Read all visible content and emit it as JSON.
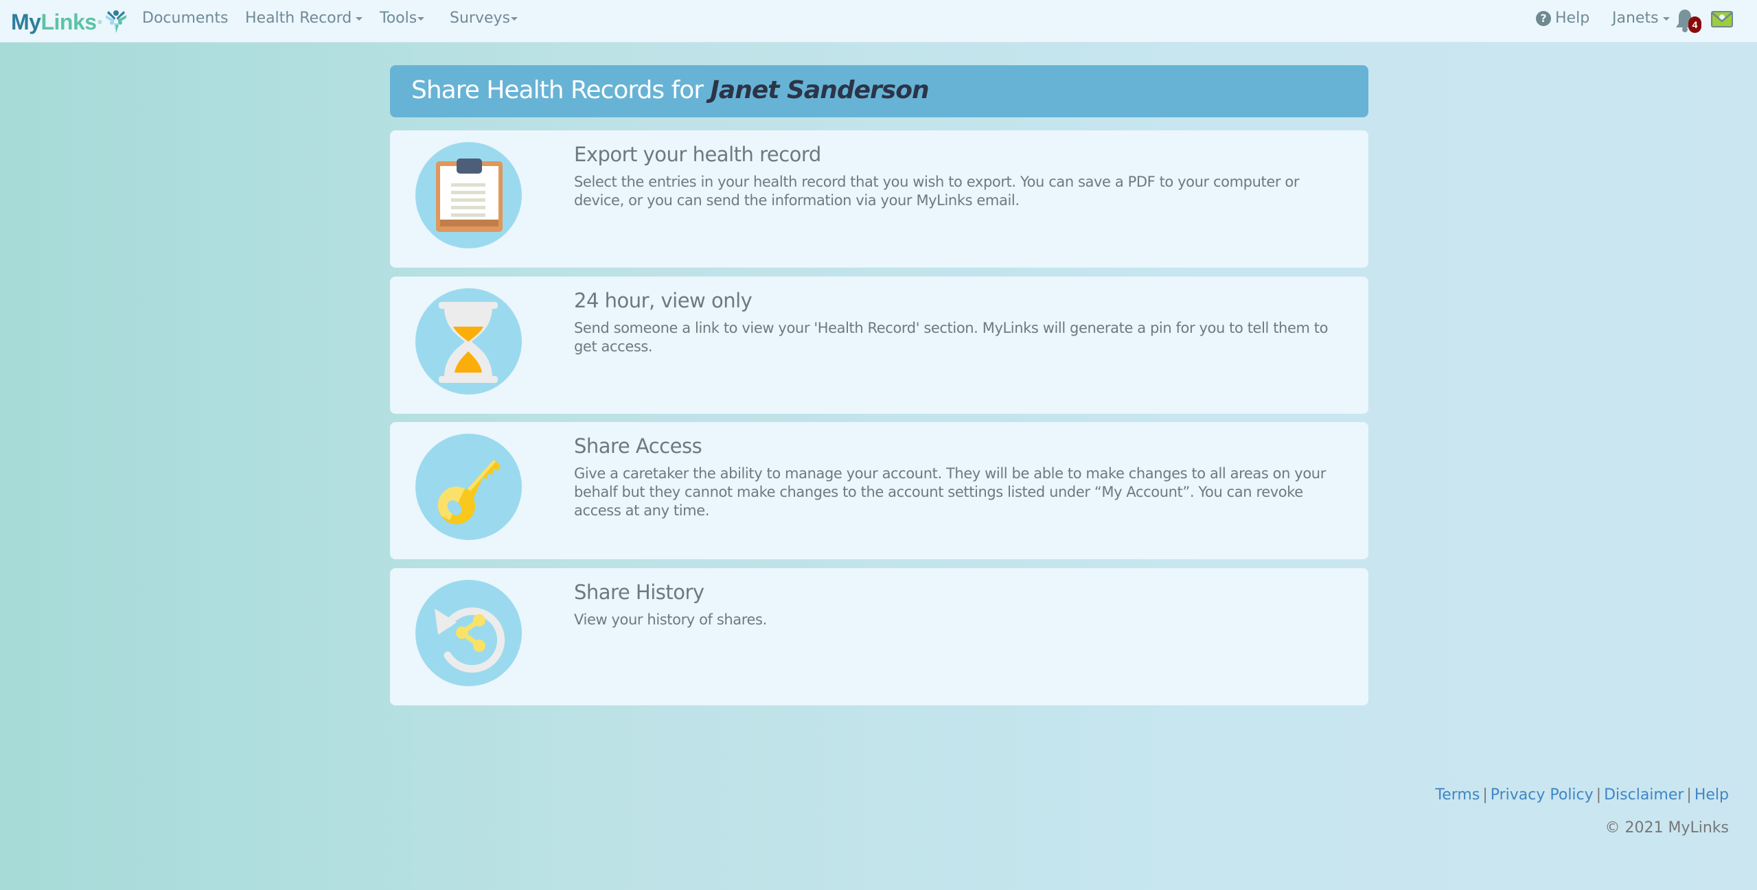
{
  "navbar": {
    "logo": {
      "my": "My",
      "links": "Links",
      "reg": "®"
    },
    "items": [
      {
        "label": "Documents",
        "has_dropdown": false
      },
      {
        "label": "Health Record",
        "has_dropdown": true
      },
      {
        "label": "Tools",
        "has_dropdown": true
      },
      {
        "label": "Surveys",
        "has_dropdown": true
      }
    ],
    "help_label": "Help",
    "help_icon": "question-circle-icon",
    "user_label": "Janets",
    "notification_icon": "bell-icon",
    "notification_count": "4",
    "mail_icon": "envelope-icon"
  },
  "banner": {
    "title_prefix": "Share Health Records for ",
    "patient_name": "Janet Sanderson"
  },
  "cards": [
    {
      "icon": "clipboard-icon",
      "title": "Export your health record",
      "description": "Select the entries in your health record that you wish to export. You can save a PDF to your computer or device, or you can send the information via your MyLinks email."
    },
    {
      "icon": "hourglass-icon",
      "title": "24 hour, view only",
      "description": "Send someone a link to view your 'Health Record' section. MyLinks will generate a pin for you to tell them to get access."
    },
    {
      "icon": "key-icon",
      "title": "Share Access",
      "description": "Give a caretaker the ability to manage your account. They will be able to make changes to all areas on your behalf but they cannot make changes to the account settings listed under “My Account”. You can revoke access at any time."
    },
    {
      "icon": "share-history-icon",
      "title": "Share History",
      "description": "View your history of shares."
    }
  ],
  "footer": {
    "links": [
      "Terms",
      "Privacy Policy",
      "Disclaimer",
      "Help"
    ],
    "separator": "|",
    "copyright": "© 2021 MyLinks"
  },
  "colors": {
    "banner": "#67b3d5",
    "card": "#ebf6fd",
    "icon_circle": "#9bdaee",
    "link": "#3f86c4",
    "badge": "#8b0a0a",
    "logo_dark": "#2c7f99",
    "logo_light": "#5cc3a4"
  }
}
